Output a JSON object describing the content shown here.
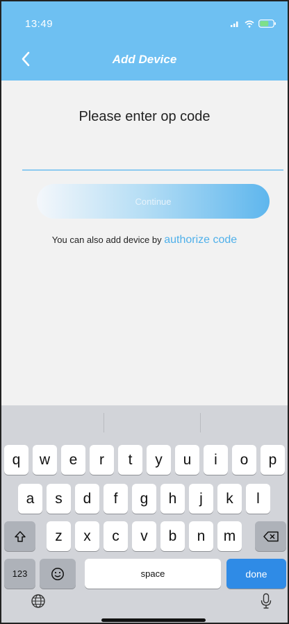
{
  "status_bar": {
    "time": "13:49"
  },
  "nav": {
    "title": "Add Device"
  },
  "content": {
    "prompt": "Please enter op code",
    "input_value": "",
    "continue_label": "Continue",
    "alt_text": "You can also add device by ",
    "alt_link": "authorize code"
  },
  "keyboard": {
    "row1": [
      "q",
      "w",
      "e",
      "r",
      "t",
      "y",
      "u",
      "i",
      "o",
      "p"
    ],
    "row2": [
      "a",
      "s",
      "d",
      "f",
      "g",
      "h",
      "j",
      "k",
      "l"
    ],
    "row3": [
      "z",
      "x",
      "c",
      "v",
      "b",
      "n",
      "m"
    ],
    "numbers_label": "123",
    "space_label": "space",
    "done_label": "done"
  },
  "colors": {
    "accent": "#6ec0f2",
    "link": "#4fb0ea",
    "done": "#2f8be6"
  }
}
